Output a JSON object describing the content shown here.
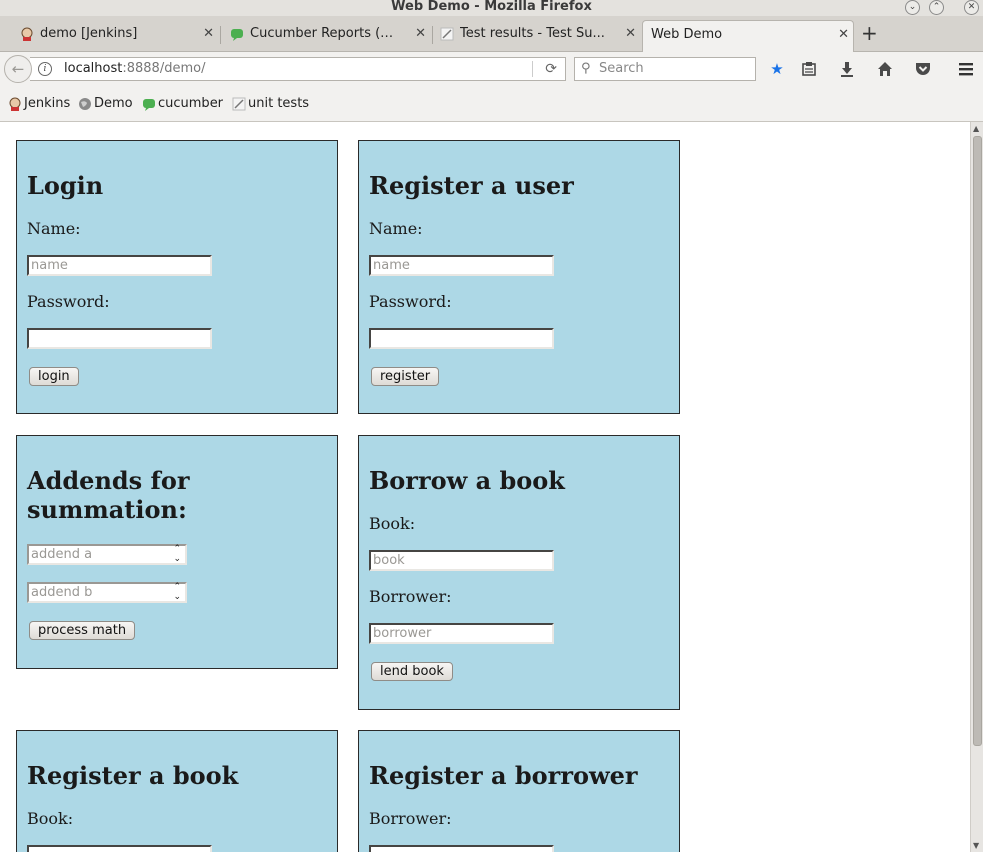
{
  "window": {
    "title": "Web Demo - Mozilla Firefox"
  },
  "tabs": [
    {
      "label": "demo [Jenkins]",
      "icon": "jenkins-icon"
    },
    {
      "label": "Cucumber Reports (n...",
      "icon": "cucumber-icon"
    },
    {
      "label": "Test results - Test Su...",
      "icon": "test-results-icon"
    },
    {
      "label": "Web Demo",
      "icon": "",
      "active": true
    }
  ],
  "nav": {
    "url_host": "localhost",
    "url_path": ":8888/demo/",
    "search_placeholder": "Search"
  },
  "bookmarks": [
    {
      "label": "Jenkins",
      "icon": "jenkins-icon"
    },
    {
      "label": "Demo",
      "icon": "globe-icon"
    },
    {
      "label": "cucumber",
      "icon": "cucumber-icon"
    },
    {
      "label": "unit tests",
      "icon": "test-results-icon"
    }
  ],
  "login": {
    "heading": "Login",
    "name_label": "Name:",
    "name_placeholder": "name",
    "password_label": "Password:",
    "button": "login"
  },
  "register_user": {
    "heading": "Register a user",
    "name_label": "Name:",
    "name_placeholder": "name",
    "password_label": "Password:",
    "button": "register"
  },
  "math": {
    "heading_line1": "Addends for",
    "heading_line2": "summation:",
    "addend_a_placeholder": "addend a",
    "addend_b_placeholder": "addend b",
    "button": "process math"
  },
  "borrow": {
    "heading": "Borrow a book",
    "book_label": "Book:",
    "book_placeholder": "book",
    "borrower_label": "Borrower:",
    "borrower_placeholder": "borrower",
    "button": "lend book"
  },
  "register_book": {
    "heading": "Register a book",
    "book_label": "Book:"
  },
  "register_borrower": {
    "heading": "Register a borrower",
    "borrower_label": "Borrower:"
  },
  "colors": {
    "panel_bg": "#add8e6",
    "bookmark_star": "#1a73e8"
  }
}
